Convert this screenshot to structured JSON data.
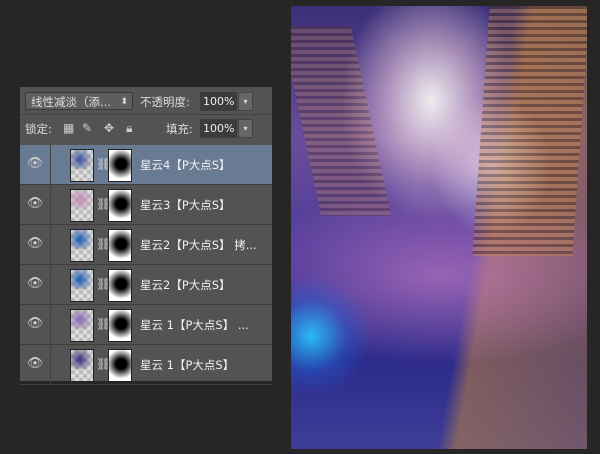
{
  "panel": {
    "blend_mode": "线性减淡（添...",
    "opacity_label": "不透明度:",
    "opacity_value": "100%",
    "lock_label": "锁定:",
    "fill_label": "填充:",
    "fill_value": "100%",
    "layers": [
      {
        "name": "星云4【P大点S】",
        "selected": true,
        "thumb": "#3a4f9a"
      },
      {
        "name": "星云3【P大点S】",
        "selected": false,
        "thumb": "#c68ab8"
      },
      {
        "name": "星云2【P大点S】 拷...",
        "selected": false,
        "thumb": "#1e5bb0"
      },
      {
        "name": "星云2【P大点S】",
        "selected": false,
        "thumb": "#1e5bb0"
      },
      {
        "name": "星云 1【P大点S】 ...",
        "selected": false,
        "thumb": "#8a6ab0"
      },
      {
        "name": "星云 1【P大点S】",
        "selected": false,
        "thumb": "#3c2f7a"
      }
    ]
  }
}
